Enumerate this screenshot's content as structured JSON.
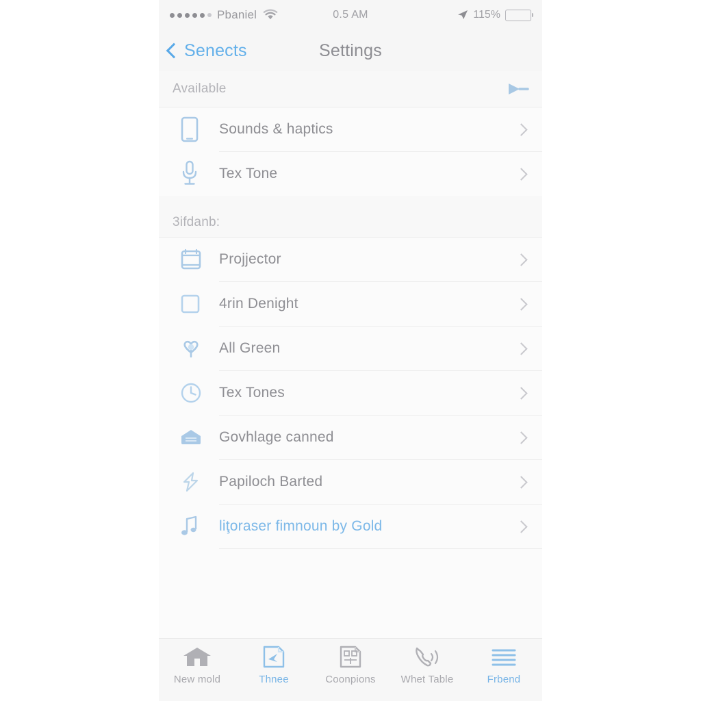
{
  "status_bar": {
    "signal_dots": 5,
    "carrier": "Pbaniel",
    "wifi_icon": "wifi-icon",
    "time": "0.5 AM",
    "location_icon": "location-arrow-icon",
    "battery_percent": "115%"
  },
  "nav_bar": {
    "back_label": "Senects",
    "back_icon": "chevron-left-icon",
    "title": "Settings"
  },
  "sections": [
    {
      "header": "Available",
      "header_icon": "send-icon",
      "rows": [
        {
          "icon": "phone-device-icon",
          "label": "Sounds & haptics",
          "accent": false
        },
        {
          "icon": "microphone-icon",
          "label": "Tex Tone",
          "accent": false
        }
      ]
    },
    {
      "header": "3ifdanb:",
      "header_icon": "",
      "rows": [
        {
          "icon": "calendar-box-icon",
          "label": "Projjector",
          "accent": false
        },
        {
          "icon": "square-outline-icon",
          "label": "4rin Denight",
          "accent": false
        },
        {
          "icon": "heart-balloon-icon",
          "label": "All Green",
          "accent": false
        },
        {
          "icon": "clock-icon",
          "label": "Tex Tones",
          "accent": false
        },
        {
          "icon": "mailbox-icon",
          "label": "Govhlage canned",
          "accent": false
        },
        {
          "icon": "lightning-bolt-icon",
          "label": "Papiloch Barted",
          "accent": false
        },
        {
          "icon": "music-note-icon",
          "label": "liţoraser fimnoun by Gold",
          "accent": true
        }
      ]
    }
  ],
  "tab_bar": [
    {
      "icon": "home-icon",
      "label": "New mold",
      "active": false
    },
    {
      "icon": "document-send-icon",
      "label": "Thnee",
      "active": true
    },
    {
      "icon": "document-grid-icon",
      "label": "Coonpions",
      "active": false
    },
    {
      "icon": "phone-call-icon",
      "label": "Whet Table",
      "active": false
    },
    {
      "icon": "hamburger-menu-icon",
      "label": "Frbend",
      "active": true
    }
  ],
  "colors": {
    "accent_blue": "#63b0ea",
    "icon_blue": "#b9d5ec",
    "text_gray": "#8e8e93",
    "muted_gray": "#b3b3b8",
    "background": "#fbfbfb",
    "chrome": "#f6f6f6"
  }
}
